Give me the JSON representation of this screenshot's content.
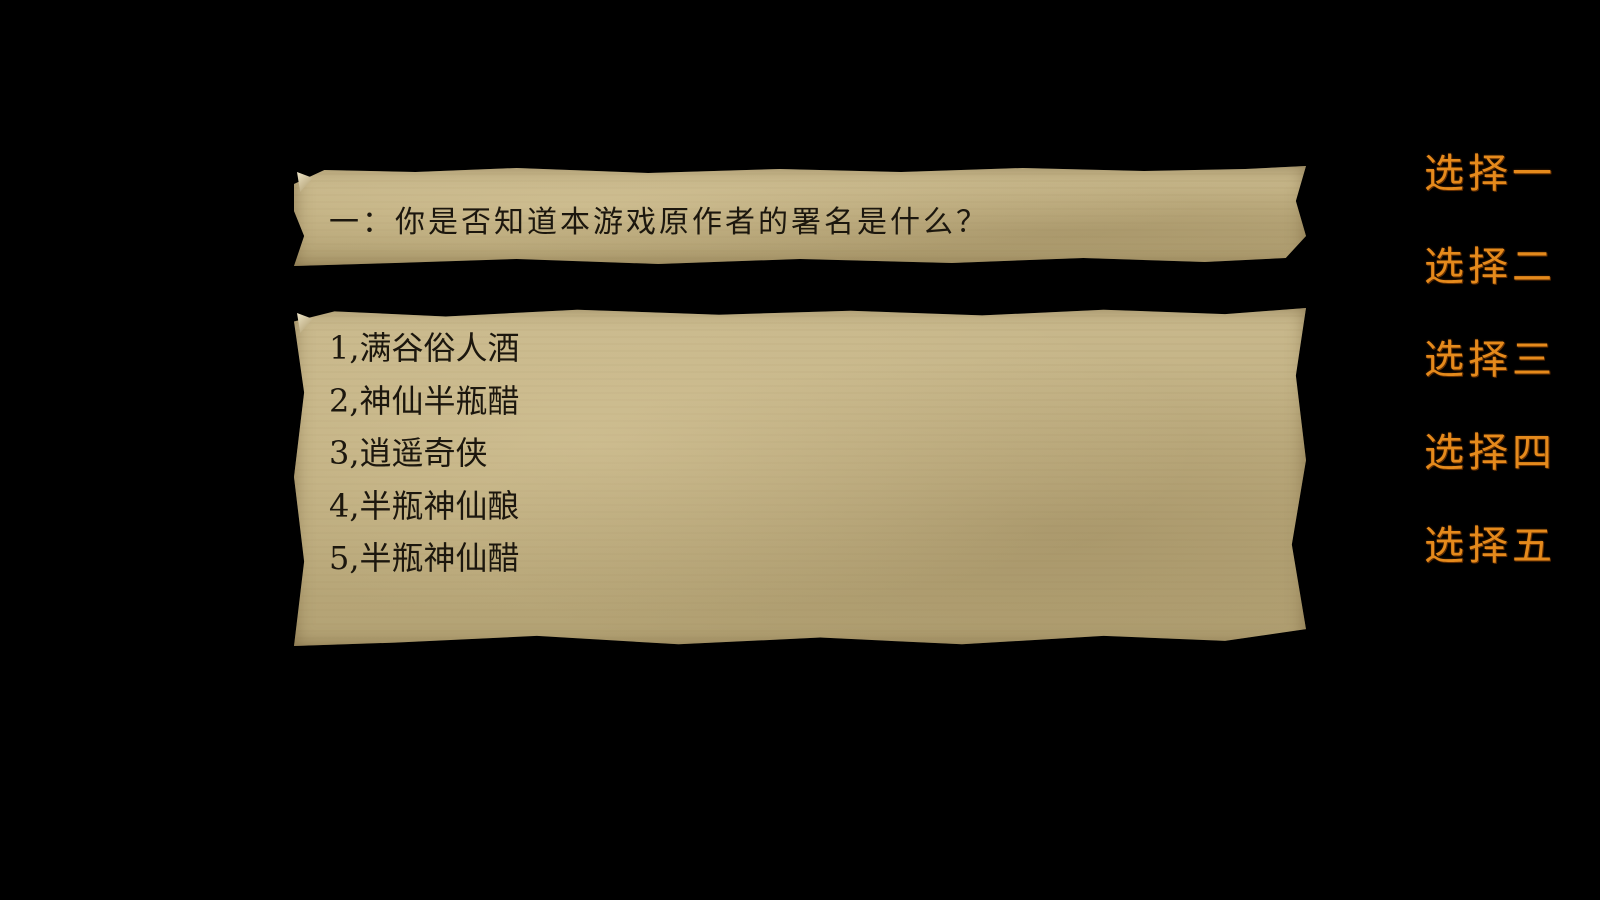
{
  "question": {
    "text": "一：你是否知道本游戏原作者的署名是什么？"
  },
  "answers": [
    "1,满谷俗人酒",
    "2,神仙半瓶醋",
    "3,逍遥奇侠",
    "4,半瓶神仙酿",
    "5,半瓶神仙醋"
  ],
  "choices": [
    "选择一",
    "选择二",
    "选择三",
    "选择四",
    "选择五"
  ],
  "colors": {
    "background": "#000000",
    "parchment": "#bfae80",
    "scroll_text": "#1c170e",
    "choice_text": "#e58a1c"
  }
}
